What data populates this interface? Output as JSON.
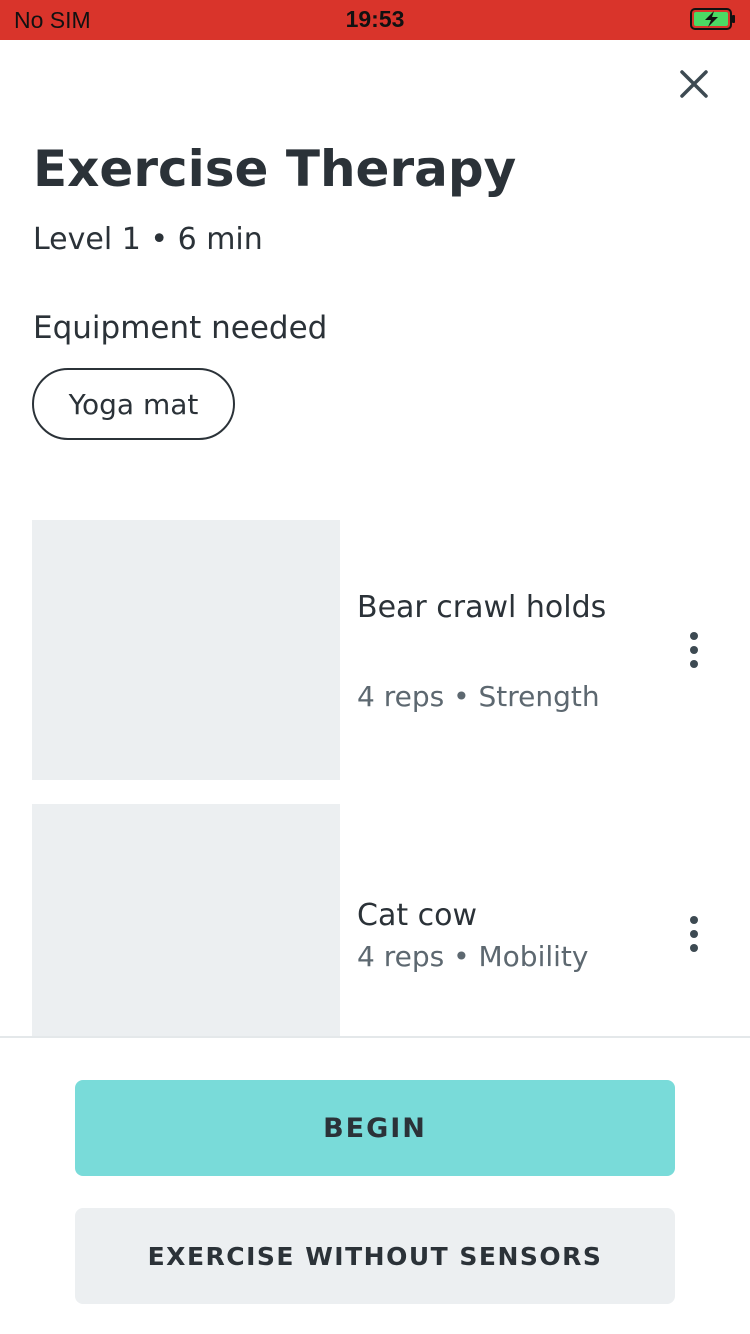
{
  "status_bar": {
    "carrier": "No SIM",
    "time": "19:53",
    "battery_icon": "battery-charging-icon"
  },
  "header": {
    "close_icon": "close-icon",
    "title": "Exercise Therapy",
    "subtitle": "Level 1 • 6 min"
  },
  "equipment": {
    "heading": "Equipment needed",
    "items": [
      "Yoga mat"
    ]
  },
  "exercises": [
    {
      "name": "Bear crawl holds",
      "meta": "4 reps • Strength"
    },
    {
      "name": "Cat cow",
      "meta": "4 reps • Mobility"
    }
  ],
  "actions": {
    "begin_label": "BEGIN",
    "no_sensors_label": "EXERCISE WITHOUT SENSORS"
  },
  "colors": {
    "status_bar": "#d9342b",
    "primary_button": "#79dbd9",
    "secondary_button": "#eceff1",
    "text": "#2b3238"
  }
}
